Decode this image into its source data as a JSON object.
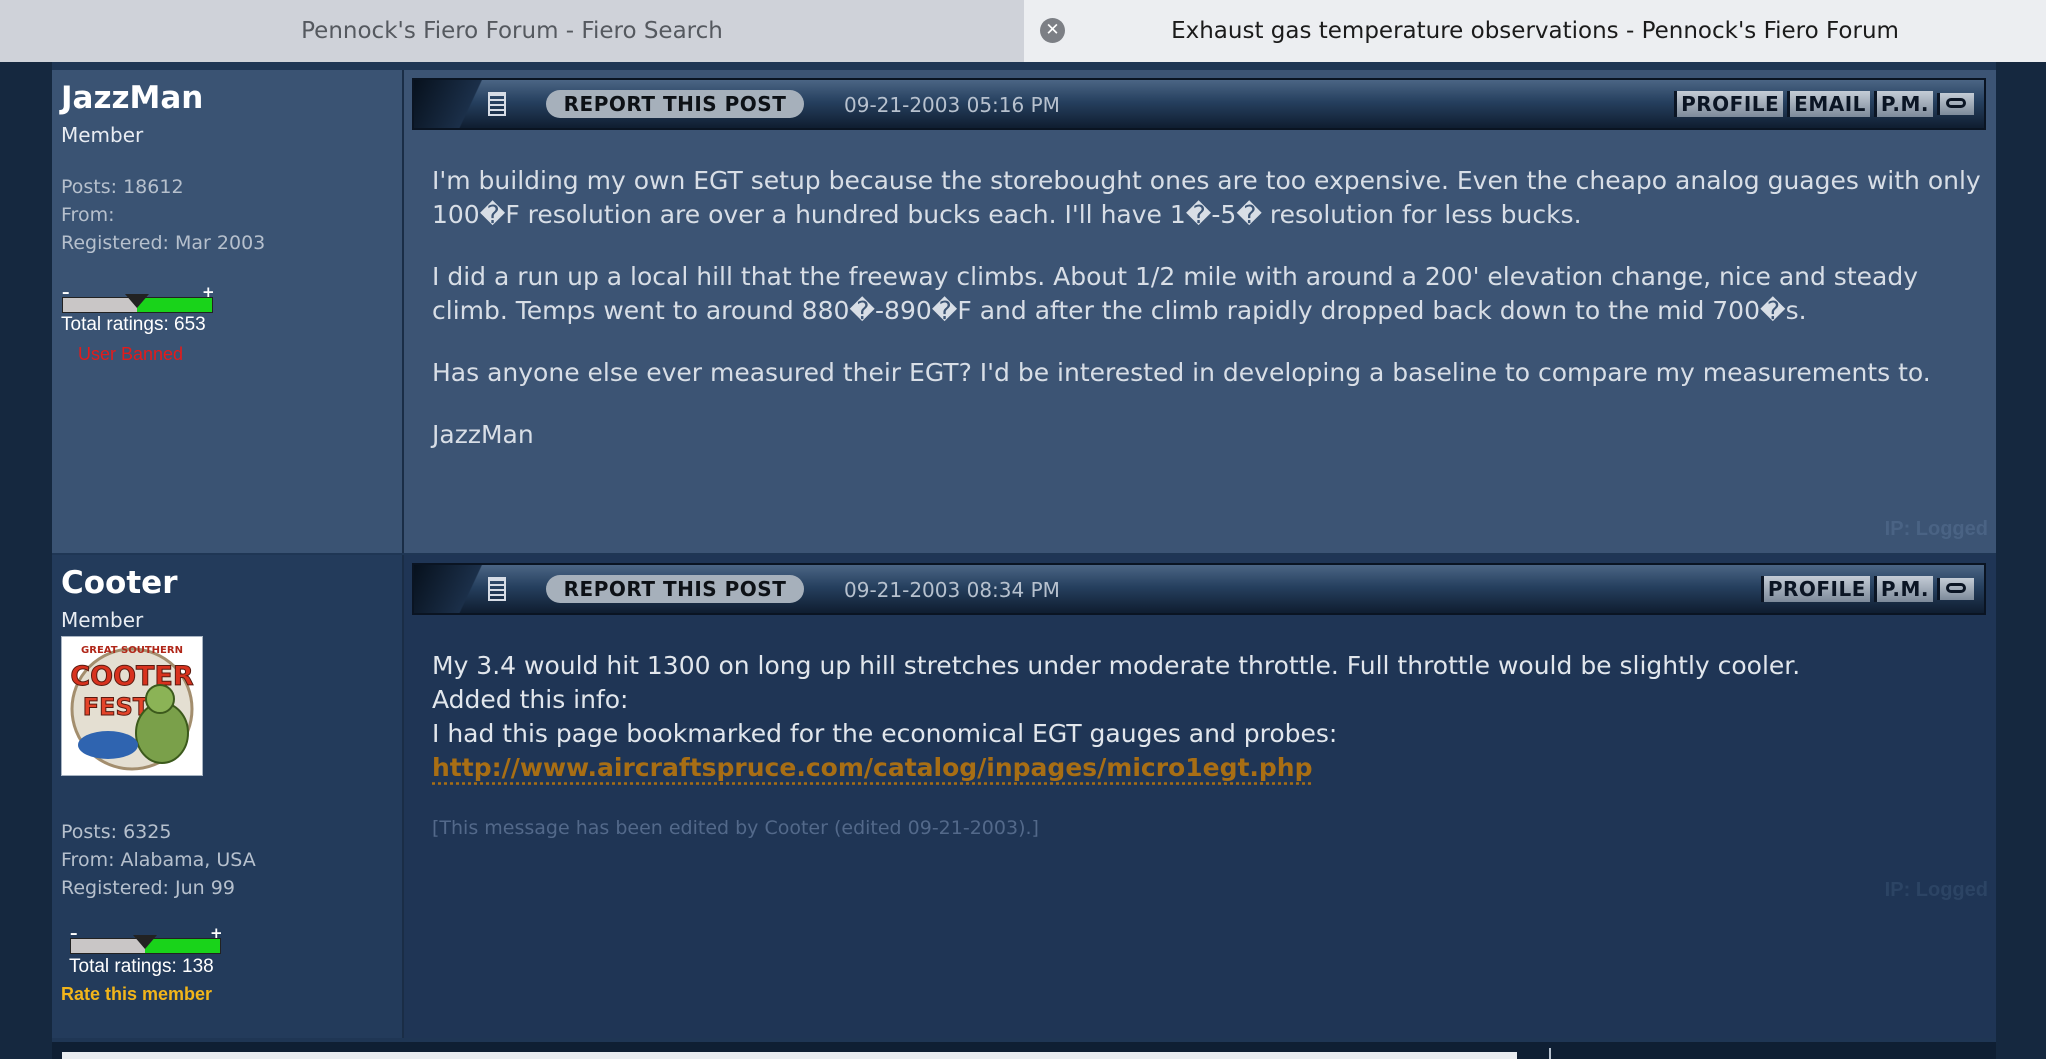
{
  "tabs": [
    {
      "label": "Pennock's Fiero Forum - Fiero Search",
      "active": false
    },
    {
      "label": "Exhaust gas temperature observations - Pennock's Fiero Forum",
      "active": true
    }
  ],
  "colors": {
    "background": "#15283f",
    "link": "#a86e14",
    "rate_link": "#f2b51a",
    "banned": "#e31b1b",
    "rating_green": "#19d31a"
  },
  "posts": [
    {
      "user": {
        "name": "JazzMan",
        "rank": "Member",
        "posts": "Posts: 18612",
        "from": "From:",
        "registered": "Registered: Mar 2003",
        "rating_fraction": 0.5,
        "total_ratings": "Total ratings: 653",
        "status": "User Banned"
      },
      "header": {
        "report": "REPORT THIS POST",
        "date": "09-21-2003 05:16 PM",
        "links": [
          "PROFILE",
          "EMAIL",
          "P.M."
        ]
      },
      "paragraphs": [
        "I'm building my own EGT setup because the storebought ones are too expensive. Even the cheapo analog guages with only 100�F resolution are over a hundred bucks each. I'll have 1�-5� resolution for less bucks.",
        "I did a run up a local hill that the freeway climbs. About 1/2 mile with around a 200' elevation change, nice and steady climb. Temps went to around 880�-890�F and after the climb rapidly dropped back down to the mid 700�s.",
        "Has anyone else ever measured their EGT? I'd be interested in developing a baseline to compare my measurements to.",
        "JazzMan"
      ],
      "ip": "IP: Logged"
    },
    {
      "user": {
        "name": "Cooter",
        "rank": "Member",
        "avatar_text": "COOTER",
        "avatar_small": "GREAT SOUTHERN",
        "avatar_big": "FEST",
        "posts": "Posts: 6325",
        "from": "From: Alabama, USA",
        "registered": "Registered: Jun 99",
        "rating_fraction": 0.5,
        "total_ratings": "Total ratings: 138",
        "rate": "Rate this member"
      },
      "header": {
        "report": "REPORT THIS POST",
        "date": "09-21-2003 08:34 PM",
        "links": [
          "PROFILE",
          "P.M."
        ]
      },
      "lines": [
        "My 3.4 would hit 1300 on long up hill stretches under moderate throttle. Full throttle would be slightly cooler.",
        "Added this info:",
        "I had this page bookmarked for the economical EGT gauges and probes:"
      ],
      "url": "http://www.aircraftspruce.com/catalog/inpages/micro1egt.php",
      "edited": "[This message has been edited by Cooter (edited 09-21-2003).]",
      "ip": "IP: Logged"
    }
  ]
}
